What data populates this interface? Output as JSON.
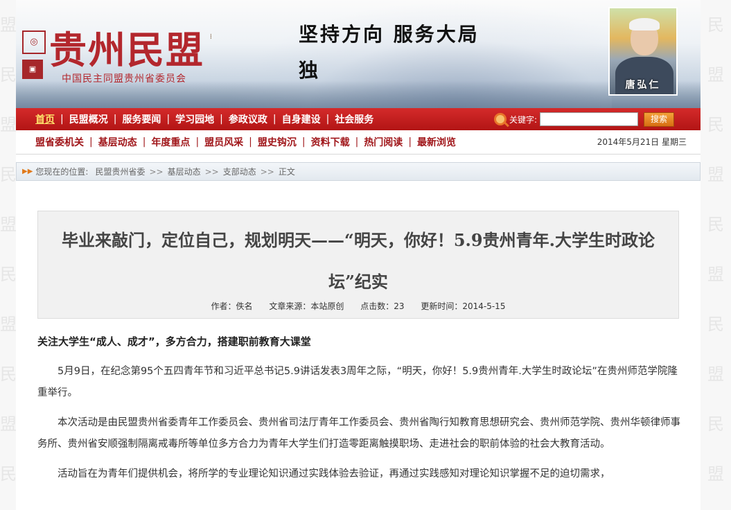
{
  "banner": {
    "logo_text": "贵州民盟",
    "logo_sub": "中国民主同盟贵州省委员会",
    "slogan_line1": "坚持方向  服务大局",
    "slogan_line2": "独",
    "portrait_name": "唐弘仁"
  },
  "main_nav": {
    "items": [
      "首页",
      "民盟概况",
      "服务要闻",
      "学习园地",
      "参政议政",
      "自身建设",
      "社会服务"
    ],
    "search_label": "关键字:",
    "search_value": "",
    "search_button": "搜索"
  },
  "sub_nav": {
    "items": [
      "盟省委机关",
      "基层动态",
      "年度重点",
      "盟员风采",
      "盟史钩沉",
      "资料下载",
      "热门阅读",
      "最新浏览"
    ],
    "date": "2014年5月21日 星期三"
  },
  "breadcrumb": {
    "prefix": "您现在的位置:",
    "items": [
      "民盟贵州省委",
      "基层动态",
      "支部动态",
      "正文"
    ]
  },
  "article": {
    "title": "毕业来敲门，定位自己，规划明天——“明天，你好！5.9贵州青年.大学生时政论坛”纪实",
    "author": "作者：佚名",
    "source": "文章来源：本站原创",
    "clicks": "点击数：23",
    "updated": "更新时间：2014-5-15",
    "subheading": "关注大学生“成人、成才”，多方合力，搭建职前教育大课堂",
    "paragraphs": [
      "5月9日，在纪念第95个五四青年节和习近平总书记5.9讲话发表3周年之际，“明天，你好！5.9贵州青年.大学生时政论坛”在贵州师范学院隆重举行。",
      "本次活动是由民盟贵州省委青年工作委员会、贵州省司法厅青年工作委员会、贵州省陶行知教育思想研究会、贵州师范学院、贵州华顿律师事务所、贵州省安顺强制隔离戒毒所等单位多方合力为青年大学生们打造零距离触摸职场、走进社会的职前体验的社会大教育活动。",
      "活动旨在为青年们提供机会，将所学的专业理论知识通过实践体验去验证，再通过实践感知对理论知识掌握不足的迫切需求，"
    ]
  }
}
